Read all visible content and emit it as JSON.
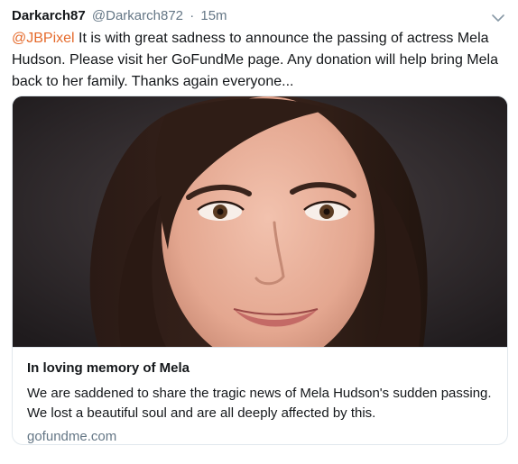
{
  "tweet": {
    "author_name": "Darkarch87",
    "author_handle": "@Darkarch872",
    "separator": "·",
    "timestamp": "15m",
    "mention": "@JBPixel",
    "body": " It is with great sadness to announce the passing of actress Mela Hudson. Please visit her GoFundMe page. Any donation will help bring Mela back to her family. Thanks again everyone..."
  },
  "card": {
    "title": "In loving memory of Mela",
    "description": "We are saddened to share the tragic news of Mela Hudson's sudden passing. We lost a beautiful soul and are all deeply affected by this.",
    "domain": "gofundme.com"
  },
  "icons": {
    "caret": "chevron-down-icon"
  },
  "colors": {
    "mention": "#e56a2b",
    "secondary_text": "#657786",
    "border": "#e1e8ed"
  }
}
